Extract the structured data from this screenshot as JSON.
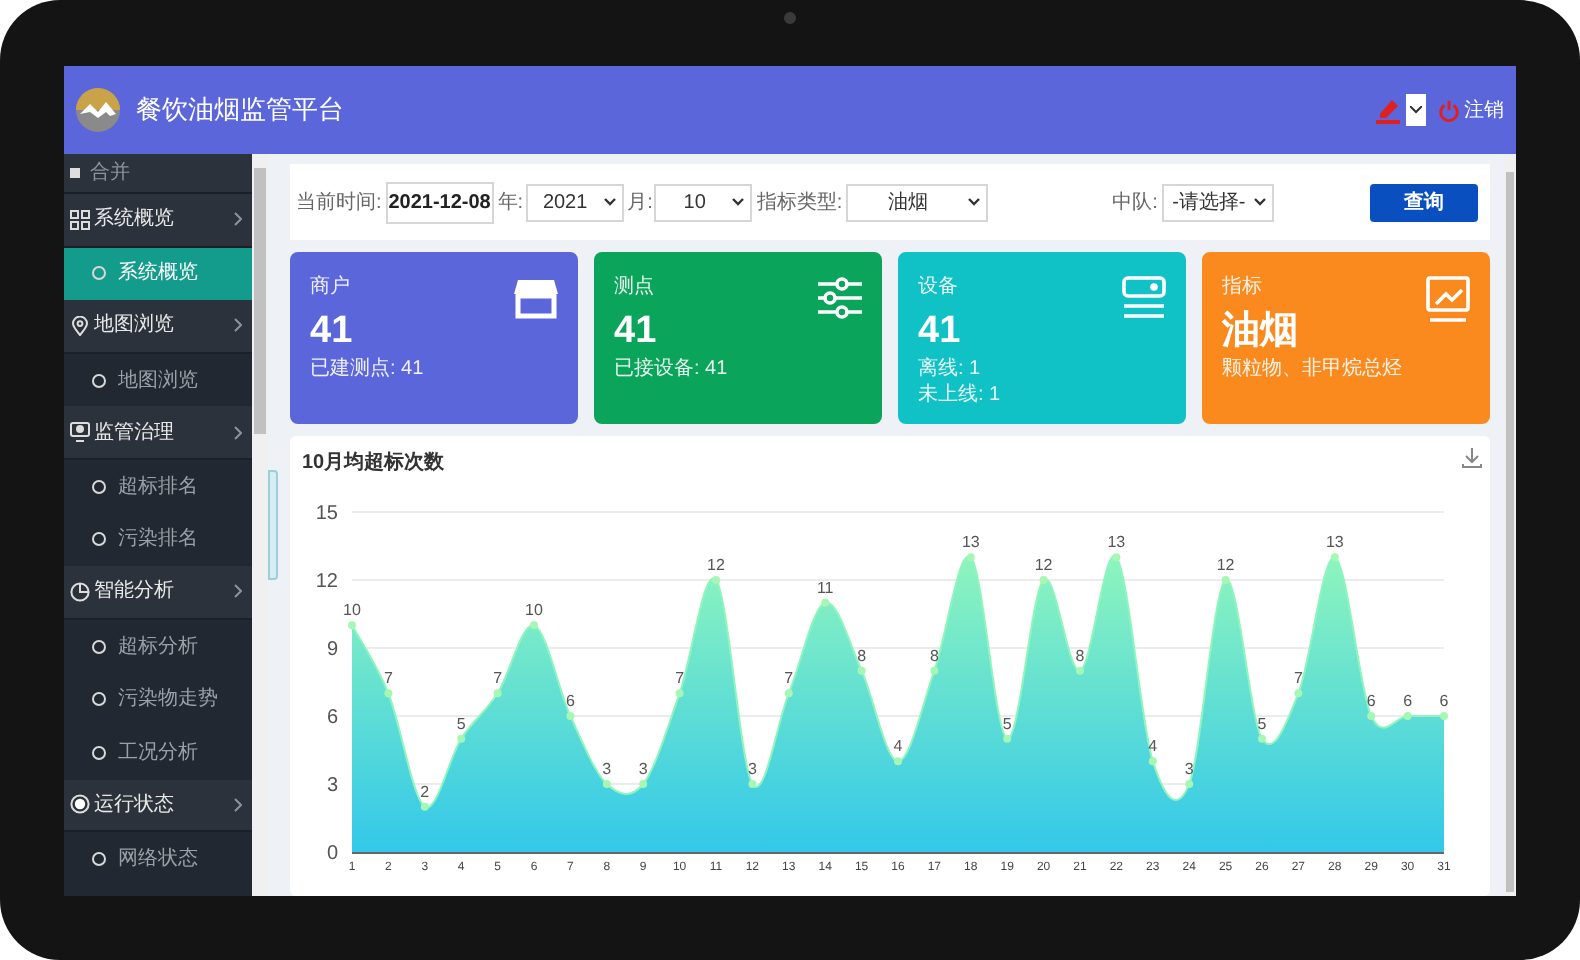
{
  "header": {
    "title": "餐饮油烟监管平台",
    "logout": "注销"
  },
  "sidebar": {
    "collapse": "合并",
    "groups": [
      {
        "label": "系统概览",
        "children": [
          {
            "label": "系统概览",
            "selected": true
          }
        ]
      },
      {
        "label": "地图浏览",
        "children": [
          {
            "label": "地图浏览",
            "selected": false
          }
        ]
      },
      {
        "label": "监管治理",
        "children": [
          {
            "label": "超标排名",
            "selected": false
          },
          {
            "label": "污染排名",
            "selected": false
          }
        ]
      },
      {
        "label": "智能分析",
        "children": [
          {
            "label": "超标分析",
            "selected": false
          },
          {
            "label": "污染物走势",
            "selected": false
          },
          {
            "label": "工况分析",
            "selected": false
          }
        ]
      },
      {
        "label": "运行状态",
        "children": [
          {
            "label": "网络状态",
            "selected": false
          }
        ]
      }
    ]
  },
  "filters": {
    "date_label": "当前时间:",
    "date": "2021-12-08",
    "year_label": "年:",
    "year": "2021",
    "month_label": "月:",
    "month": "10",
    "type_label": "指标类型:",
    "type": "油烟",
    "squad_label": "中队:",
    "squad": "-请选择-",
    "query": "查询"
  },
  "cards": [
    {
      "title": "商户",
      "value": "41",
      "notes": [
        "已建测点: 41"
      ],
      "color": "#5b66db"
    },
    {
      "title": "测点",
      "value": "41",
      "notes": [
        "已接设备: 41"
      ],
      "color": "#0aa45b"
    },
    {
      "title": "设备",
      "value": "41",
      "notes": [
        "离线: 1",
        "未上线: 1"
      ],
      "color": "#10c1c5"
    },
    {
      "title": "指标",
      "value": "油烟",
      "notes": [
        "颗粒物、非甲烷总烃"
      ],
      "color": "#fb8a1e"
    }
  ],
  "chart": {
    "chart_data": {
      "type": "area",
      "title": "10月均超标次数",
      "categories": [
        "1",
        "2",
        "3",
        "4",
        "5",
        "6",
        "7",
        "8",
        "9",
        "10",
        "11",
        "12",
        "13",
        "14",
        "15",
        "16",
        "17",
        "18",
        "19",
        "20",
        "21",
        "22",
        "23",
        "24",
        "25",
        "26",
        "27",
        "28",
        "29",
        "30",
        "31"
      ],
      "series": [
        {
          "color": "#8ef5bd",
          "values": [
            10,
            7,
            2,
            5,
            7,
            10,
            6,
            3,
            3,
            7,
            12,
            3,
            7,
            11,
            8,
            4,
            8,
            13,
            5,
            12,
            8,
            13,
            4,
            3,
            12,
            5,
            7,
            13,
            6,
            6,
            6
          ]
        }
      ],
      "grid": true,
      "ylim": [
        0,
        15
      ],
      "yticks": [
        0,
        3,
        6,
        9,
        12,
        15
      ],
      "data_labels": true
    }
  }
}
